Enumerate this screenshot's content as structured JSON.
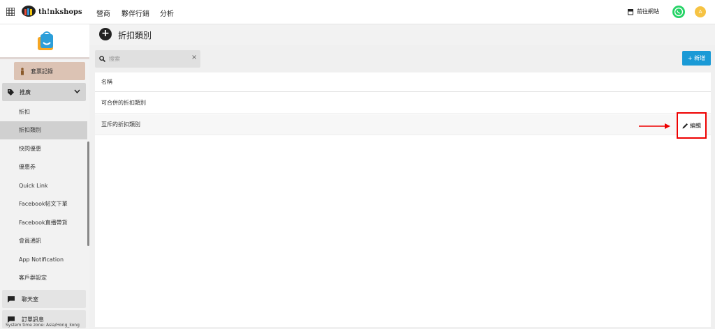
{
  "topbar": {
    "brand": "th!nkshops",
    "tabs": [
      "營商",
      "夥伴行銷",
      "分析"
    ],
    "goto_site": "前往網站",
    "avatar_letter": "A"
  },
  "sidebar": {
    "tickets": "套票記錄",
    "promo": "推廣",
    "items": [
      "折扣",
      "折扣類別",
      "快閃優惠",
      "優惠券",
      "Quick Link",
      "Facebook帖文下單",
      "Facebook直播帶貨",
      "會員通訊",
      "App Notification",
      "客戶群設定"
    ],
    "chat": "聊天室",
    "orders": "訂單訊息",
    "timezone": "System time zone: Asia/Hong_kong"
  },
  "page": {
    "title": "折扣類別",
    "search_placeholder": "搜索",
    "new_button": "+ 新增",
    "table_header": "名稱",
    "rows": [
      "可合併的折扣類別",
      "互斥的折扣類別"
    ],
    "edit_label": "編輯"
  },
  "colors": {
    "accent": "#1a9ad6",
    "highlight": "#ee0000",
    "whatsapp": "#25d366",
    "avatar": "#f6c343"
  }
}
